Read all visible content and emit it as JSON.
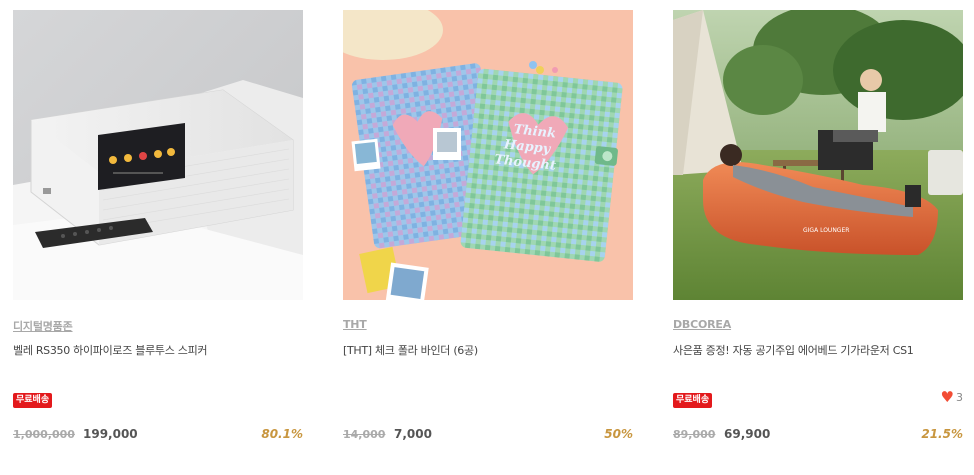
{
  "products": [
    {
      "image_alt": "speaker-image",
      "brand": "디지털명품존",
      "title": "벨레 RS350 하이파이로즈 블루투스 스피커",
      "free_shipping": "무료배송",
      "original_price": "1,000,000",
      "sale_price": "199,000",
      "discount": "80.1%",
      "likes": ""
    },
    {
      "image_alt": "binder-image",
      "brand": "THT",
      "title": "[THT] 체크 폴라 바인더 (6공)",
      "free_shipping": "",
      "original_price": "14,000",
      "sale_price": "7,000",
      "discount": "50%",
      "likes": ""
    },
    {
      "image_alt": "air-lounger-image",
      "brand": "DBCOREA",
      "title": "사은품 증정! 자동 공기주입 에어베드 기가라운저 CS1",
      "free_shipping": "무료배송",
      "original_price": "89,000",
      "sale_price": "69,900",
      "discount": "21.5%",
      "likes": "3"
    }
  ],
  "product_image_text": {
    "speaker_remote": "",
    "binder_cover_line1": "Think",
    "binder_cover_line2": "Happy",
    "binder_cover_line3": "Thought",
    "lounger_brand": "GIGA LOUNGER"
  },
  "colors": {
    "badge": "#e3191c",
    "discount": "#c8963f",
    "heart": "#f24d35",
    "brand": "#a8a8a8"
  }
}
